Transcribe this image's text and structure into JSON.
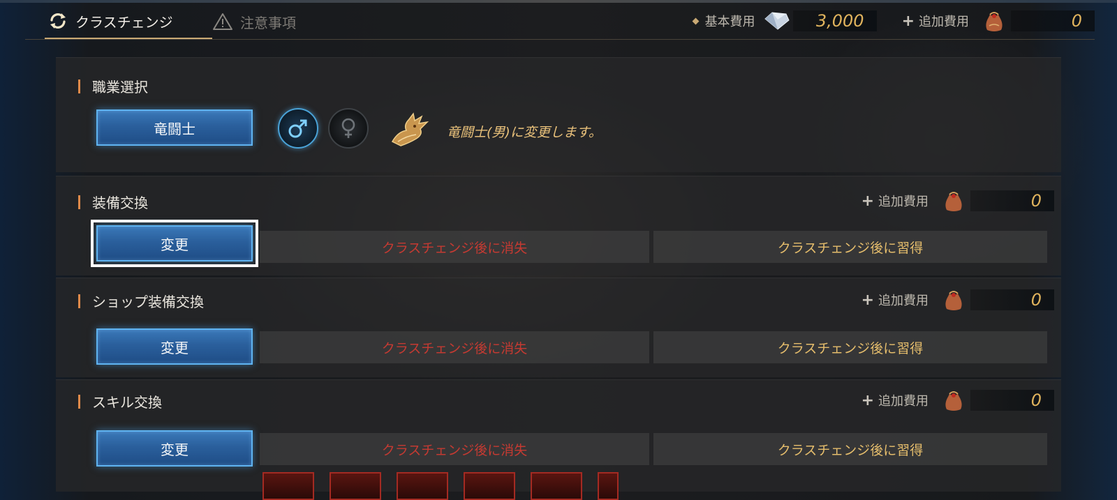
{
  "header": {
    "tabs": [
      {
        "label": "クラスチェンジ",
        "icon": "refresh-icon",
        "active": true
      },
      {
        "label": "注意事項",
        "icon": "warning-icon",
        "active": false
      }
    ],
    "base_cost_label": "基本費用",
    "base_cost_value": "3,000",
    "base_cost_icon": "crystal-icon",
    "extra_cost_label": "追加費用",
    "extra_cost_value": "0",
    "extra_cost_icon": "pouch-icon"
  },
  "class_select": {
    "title": "職業選択",
    "class_button": "竜闘士",
    "gender_options": [
      "♂",
      "♀"
    ],
    "selected_gender": "♂",
    "message": "竜闘士(男)に変更します。",
    "message_icon": "dragon-emblem-icon"
  },
  "sections": [
    {
      "title": "装備交換",
      "extra_cost_label": "追加費用",
      "extra_cost_value": "0",
      "button": "変更",
      "lose_label": "クラスチェンジ後に消失",
      "gain_label": "クラスチェンジ後に習得"
    },
    {
      "title": "ショップ装備交換",
      "extra_cost_label": "追加費用",
      "extra_cost_value": "0",
      "button": "変更",
      "lose_label": "クラスチェンジ後に消失",
      "gain_label": "クラスチェンジ後に習得"
    },
    {
      "title": "スキル交換",
      "extra_cost_label": "追加費用",
      "extra_cost_value": "0",
      "button": "変更",
      "lose_label": "クラスチェンジ後に消失",
      "gain_label": "クラスチェンジ後に習得"
    }
  ],
  "colors": {
    "accent_gold": "#e0b35d",
    "lose_red": "#c43a32",
    "gain_gold": "#e5bd6c",
    "button_blue": "#2a5f9c",
    "section_bar": "#e08a4a"
  }
}
